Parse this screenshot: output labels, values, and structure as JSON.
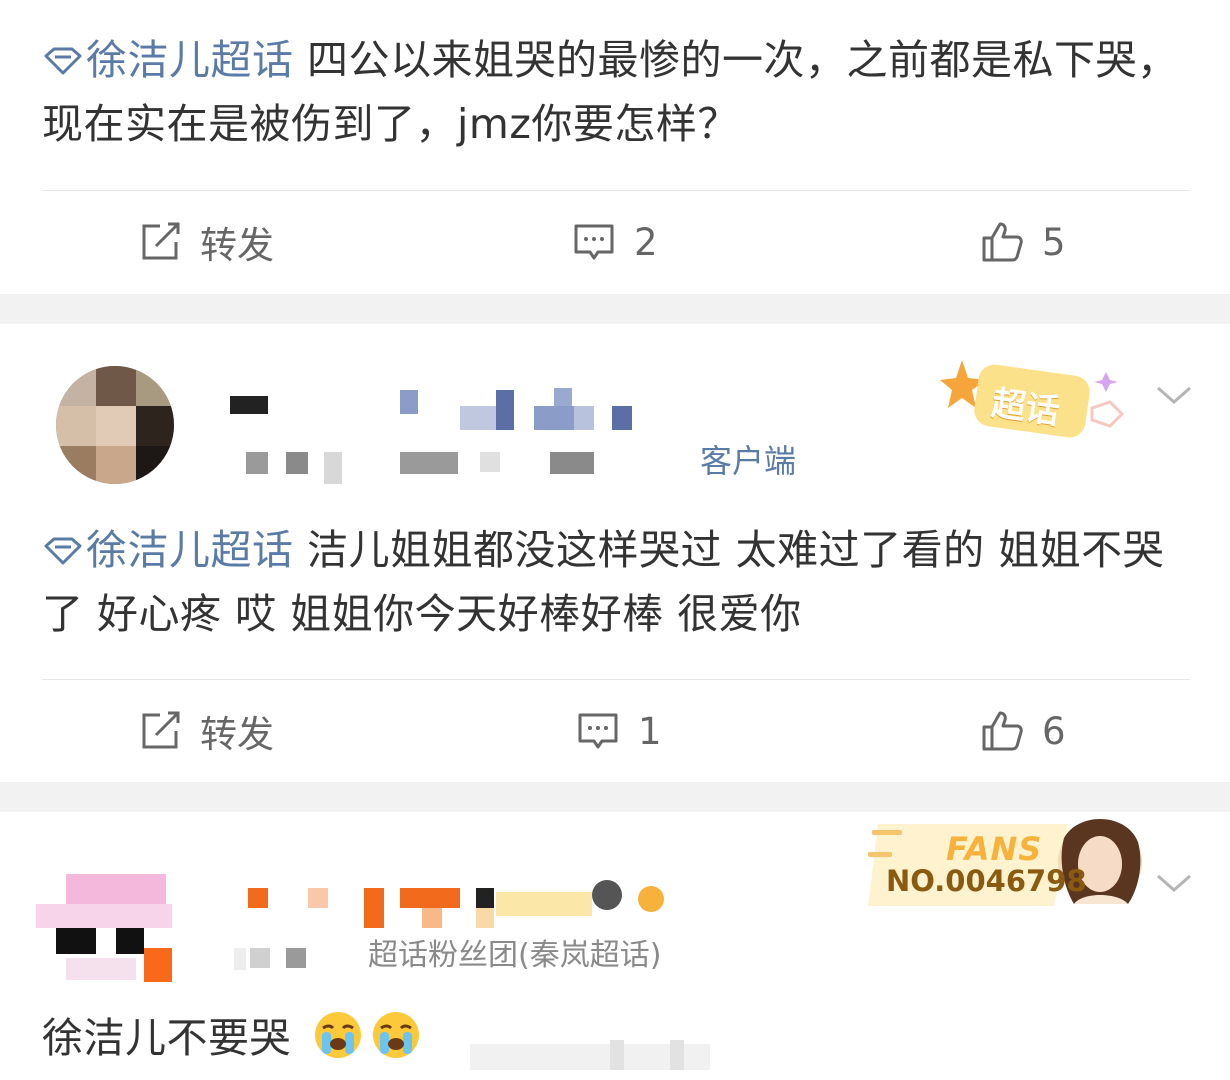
{
  "posts": [
    {
      "topic": "徐洁儿超话",
      "text": "四公以来姐哭的最惨的一次，之前都是私下哭，现在实在是被伤到了，jmz你要怎样？",
      "actions": {
        "repost_label": "转发",
        "comment_count": "2",
        "like_count": "5"
      }
    },
    {
      "meta_suffix": "客户端",
      "badge_text": "超话",
      "topic": "徐洁儿超话",
      "text": "洁儿姐姐都没这样哭过 太难过了看的 姐姐不哭了 好心疼 哎 姐姐你今天好棒好棒 很爱你",
      "actions": {
        "repost_label": "转发",
        "comment_count": "1",
        "like_count": "6"
      }
    },
    {
      "meta_text": "超话粉丝团(秦岚超话)",
      "fans_word": "FANS",
      "fans_number": "NO.0046798",
      "text": "徐洁儿不要哭"
    }
  ],
  "icons": [
    "topic-diamond-icon",
    "repost-icon",
    "comment-icon",
    "like-icon",
    "chevron-down-icon",
    "crying-emoji-icon"
  ],
  "colors": {
    "topic_blue": "#5a7ba6",
    "text": "#333333",
    "action_grey": "#666666",
    "separator": "#f2f2f2",
    "badge_gold": "#f6b23a"
  }
}
